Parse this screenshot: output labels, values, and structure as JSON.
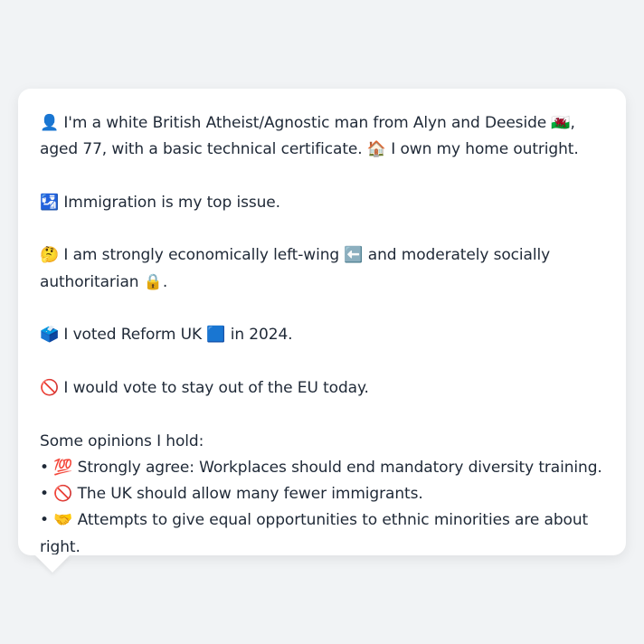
{
  "profile": {
    "intro": {
      "icon": "👤",
      "text_a": " I'm a white British Atheist/Agnostic man from Alyn and Deeside ",
      "flag": "🏴󠁧󠁢󠁷󠁬󠁳󠁿",
      "text_b": ", aged 77, with a basic technical certificate. ",
      "home_icon": "🏠",
      "text_c": " I own my home outright."
    },
    "issue": {
      "icon": "🛂",
      "text": " Immigration is my top issue."
    },
    "ideology": {
      "icon": "🤔",
      "text_a": " I am strongly economically left-wing ",
      "left_icon": "⬅️",
      "text_b": " and moderately socially authoritarian ",
      "lock_icon": "🔒",
      "text_c": "."
    },
    "vote": {
      "icon": "🗳️",
      "text_a": " I voted Reform UK ",
      "party_icon": "🟦",
      "text_b": " in 2024."
    },
    "eu": {
      "icon": "🚫",
      "text": " I would vote to stay out of the EU today."
    },
    "opinions": {
      "heading": "Some opinions I hold:",
      "items": [
        {
          "bullet": "•",
          "icon": "💯",
          "text": " Strongly agree: Workplaces should end mandatory diversity training."
        },
        {
          "bullet": "•",
          "icon": "🚫",
          "text": " The UK should allow many fewer immigrants."
        },
        {
          "bullet": "•",
          "icon": "🤝",
          "text": " Attempts to give equal opportunities to ethnic minorities are about right."
        }
      ]
    }
  }
}
